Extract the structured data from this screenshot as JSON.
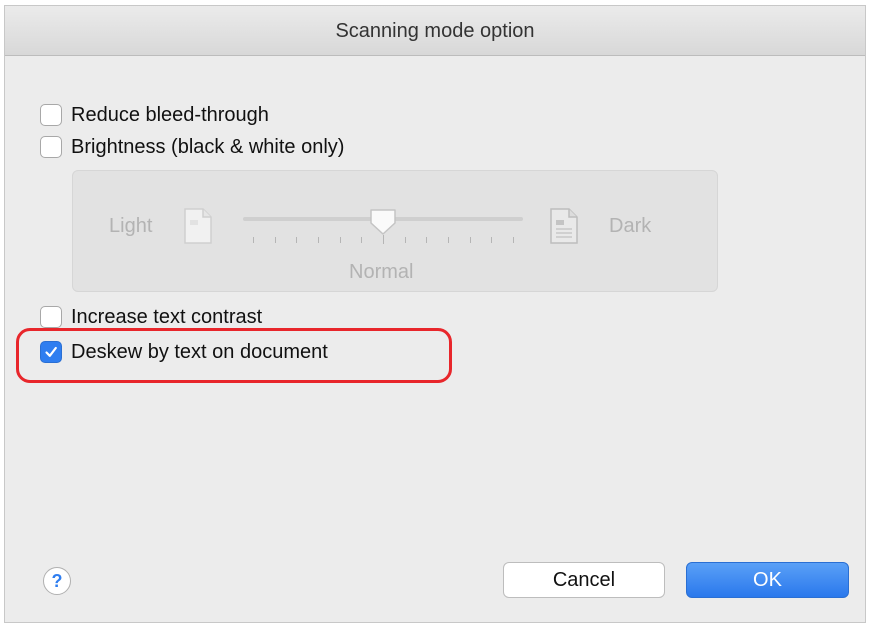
{
  "window": {
    "title": "Scanning mode option"
  },
  "options": {
    "reduce_bleed_through": {
      "label": "Reduce bleed-through",
      "checked": false
    },
    "brightness": {
      "label": "Brightness (black & white only)",
      "checked": false
    },
    "increase_text_contrast": {
      "label": "Increase text contrast",
      "checked": false
    },
    "deskew": {
      "label": "Deskew by text on document",
      "checked": true
    }
  },
  "brightness_slider": {
    "min_label": "Light",
    "max_label": "Dark",
    "center_label": "Normal",
    "enabled": false,
    "value_fraction": 0.5,
    "tick_count": 13
  },
  "footer": {
    "help_label": "?",
    "cancel_label": "Cancel",
    "ok_label": "OK"
  },
  "colors": {
    "accent": "#2f7ef0",
    "highlight": "#e8262b"
  }
}
